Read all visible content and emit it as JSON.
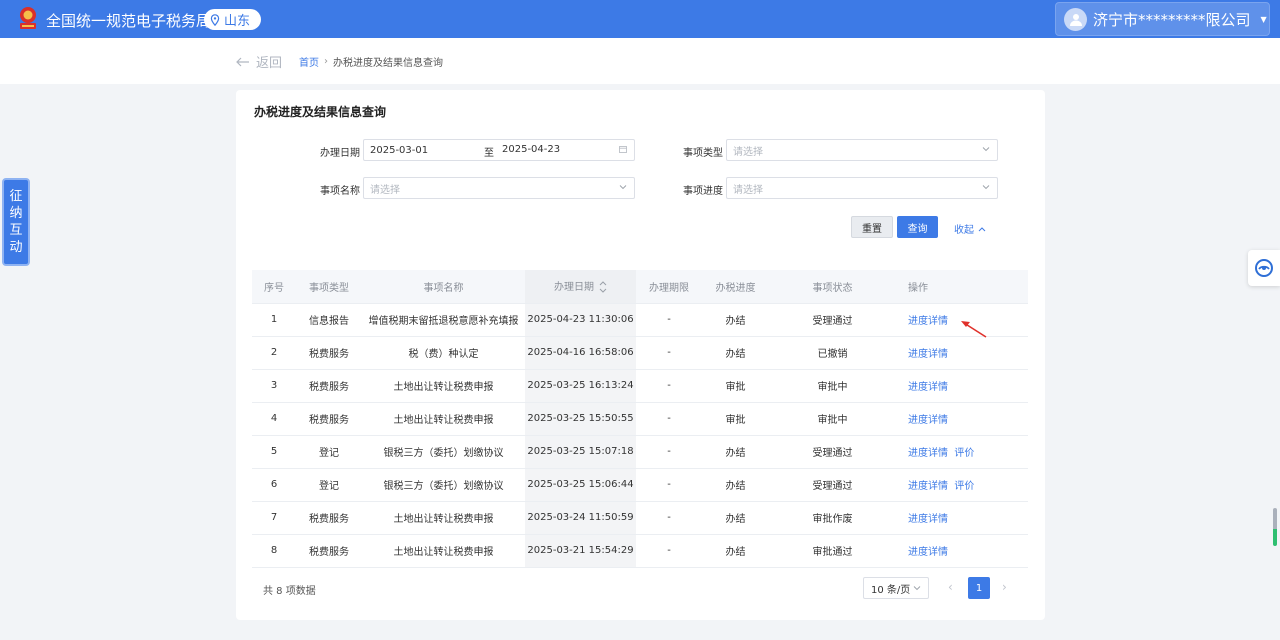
{
  "header": {
    "site_title": "全国统一规范电子税务局",
    "region": "山东",
    "user_name": "济宁市*********限公司"
  },
  "nav": {
    "back_label": "返回",
    "breadcrumb_home": "首页",
    "breadcrumb_sep": "›",
    "breadcrumb_current": "办税进度及结果信息查询"
  },
  "side_tab": {
    "chars": [
      "征",
      "纳",
      "互",
      "动"
    ]
  },
  "page": {
    "title": "办税进度及结果信息查询"
  },
  "filters": {
    "date_label": "办理日期",
    "date_start": "2025-03-01",
    "date_sep": "至",
    "date_end": "2025-04-23",
    "item_type_label": "事项类型",
    "item_type_placeholder": "请选择",
    "item_name_label": "事项名称",
    "item_name_placeholder": "请选择",
    "item_progress_label": "事项进度",
    "item_progress_placeholder": "请选择",
    "reset_label": "重置",
    "query_label": "查询",
    "collapse_label": "收起"
  },
  "table": {
    "headers": [
      "序号",
      "事项类型",
      "事项名称",
      "办理日期",
      "办理期限",
      "办税进度",
      "事项状态",
      "操作"
    ],
    "rows": [
      {
        "no": "1",
        "type": "信息报告",
        "name": "增值税期末留抵退税意愿补充填报",
        "date": "2025-04-23 11:30:06",
        "limit": "-",
        "progress": "办结",
        "status": "受理通过",
        "ops": [
          "进度详情"
        ]
      },
      {
        "no": "2",
        "type": "税费服务",
        "name": "税（费）种认定",
        "date": "2025-04-16 16:58:06",
        "limit": "-",
        "progress": "办结",
        "status": "已撤销",
        "ops": [
          "进度详情"
        ]
      },
      {
        "no": "3",
        "type": "税费服务",
        "name": "土地出让转让税费申报",
        "date": "2025-03-25 16:13:24",
        "limit": "-",
        "progress": "审批",
        "status": "审批中",
        "ops": [
          "进度详情"
        ]
      },
      {
        "no": "4",
        "type": "税费服务",
        "name": "土地出让转让税费申报",
        "date": "2025-03-25 15:50:55",
        "limit": "-",
        "progress": "审批",
        "status": "审批中",
        "ops": [
          "进度详情"
        ]
      },
      {
        "no": "5",
        "type": "登记",
        "name": "银税三方（委托）划缴协议",
        "date": "2025-03-25 15:07:18",
        "limit": "-",
        "progress": "办结",
        "status": "受理通过",
        "ops": [
          "进度详情",
          "评价"
        ]
      },
      {
        "no": "6",
        "type": "登记",
        "name": "银税三方（委托）划缴协议",
        "date": "2025-03-25 15:06:44",
        "limit": "-",
        "progress": "办结",
        "status": "受理通过",
        "ops": [
          "进度详情",
          "评价"
        ]
      },
      {
        "no": "7",
        "type": "税费服务",
        "name": "土地出让转让税费申报",
        "date": "2025-03-24 11:50:59",
        "limit": "-",
        "progress": "办结",
        "status": "审批作废",
        "ops": [
          "进度详情"
        ]
      },
      {
        "no": "8",
        "type": "税费服务",
        "name": "土地出让转让税费申报",
        "date": "2025-03-21 15:54:29",
        "limit": "-",
        "progress": "办结",
        "status": "审批通过",
        "ops": [
          "进度详情"
        ]
      }
    ]
  },
  "pagination": {
    "total_text": "共 8 项数据",
    "page_size": "10 条/页",
    "prev": "‹",
    "current_page": "1",
    "next": "›"
  },
  "colors": {
    "primary": "#3d7ae6",
    "annotation_arrow": "#e0312b"
  }
}
